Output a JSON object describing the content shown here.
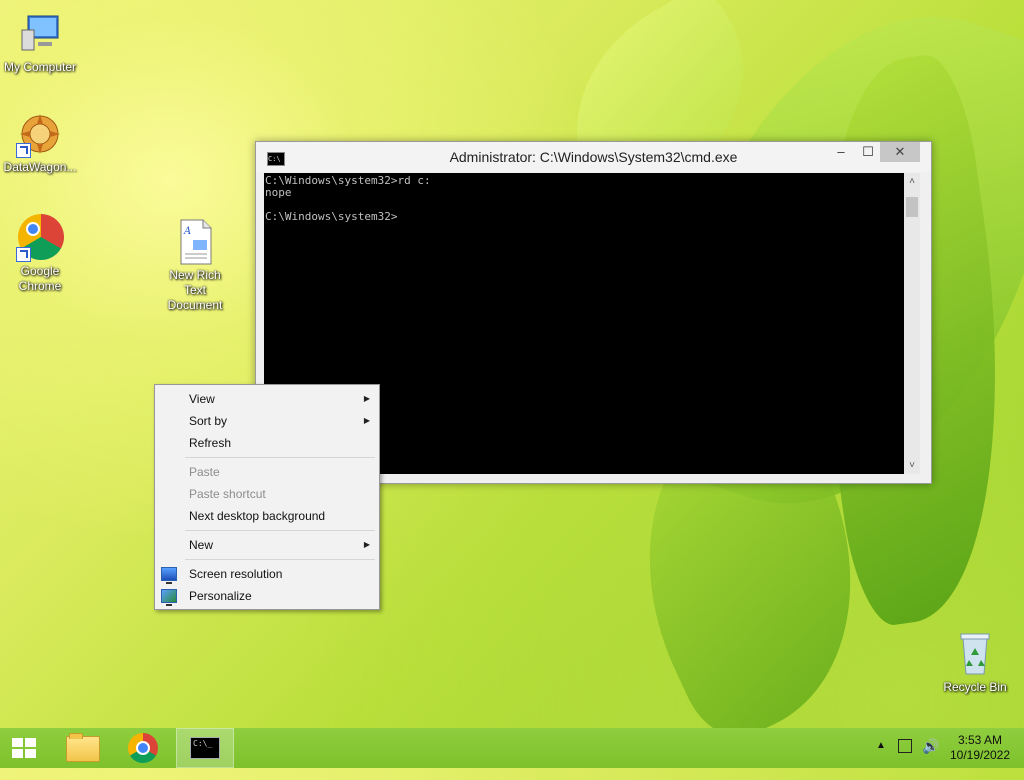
{
  "desktop": {
    "icons": [
      {
        "label": "My Computer"
      },
      {
        "label": "DataWagon..."
      },
      {
        "label": "Google Chrome"
      },
      {
        "label": "New Rich Text Document"
      },
      {
        "label": "Recycle Bin"
      }
    ]
  },
  "cmd": {
    "title": "Administrator: C:\\Windows\\System32\\cmd.exe",
    "icon_text": "C:\\",
    "lines": [
      "C:\\Windows\\system32>rd c:",
      "nope",
      "",
      "C:\\Windows\\system32>"
    ],
    "buttons": {
      "minimize": "–",
      "maximize": "☐",
      "close": "✕"
    }
  },
  "context_menu": {
    "items": [
      {
        "label": "View",
        "submenu": true,
        "disabled": false
      },
      {
        "label": "Sort by",
        "submenu": true,
        "disabled": false
      },
      {
        "label": "Refresh",
        "submenu": false,
        "disabled": false
      },
      {
        "label": "Paste",
        "submenu": false,
        "disabled": true
      },
      {
        "label": "Paste shortcut",
        "submenu": false,
        "disabled": true
      },
      {
        "label": "Next desktop background",
        "submenu": false,
        "disabled": false
      },
      {
        "label": "New",
        "submenu": true,
        "disabled": false
      },
      {
        "label": "Screen resolution",
        "submenu": false,
        "disabled": false,
        "icon": "monitor-icon"
      },
      {
        "label": "Personalize",
        "submenu": false,
        "disabled": false,
        "icon": "personalize-icon"
      }
    ],
    "submenu_arrow": "▶"
  },
  "taskbar": {
    "cmd_icon_text": "C:\\_",
    "tray_up": "▲",
    "volume": "🔊",
    "time": "3:53 AM",
    "date": "10/19/2022"
  },
  "colors": {
    "taskbar": "#8fce3e",
    "cmd_background": "#000000",
    "cmd_text": "#c0c0c0",
    "menu_background": "#f2f2f2"
  }
}
